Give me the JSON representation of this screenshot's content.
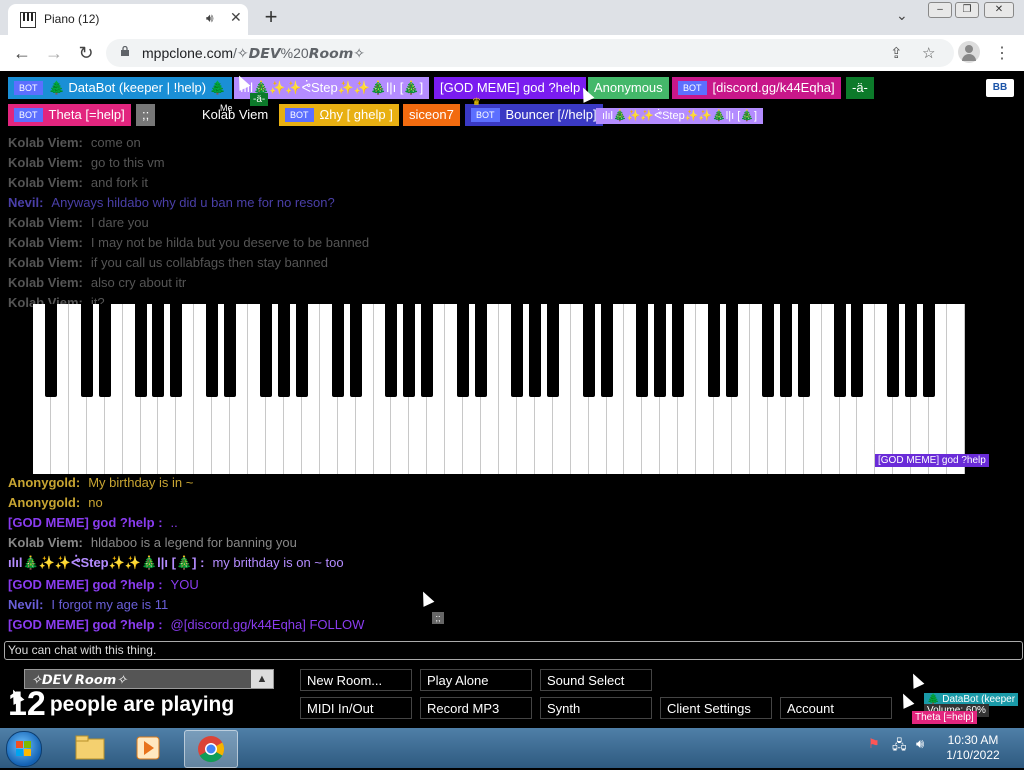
{
  "browser": {
    "tab_title": "Piano (12)",
    "url_host": "mppclone.com",
    "url_path": "/✧𝘿𝙀𝙑%20𝙍𝙤𝙤𝙢✧"
  },
  "users": [
    {
      "label": "🌲 DataBot (keeper | !help) 🌲",
      "bot": true,
      "color": "#1a8fd6"
    },
    {
      "label": "ılıl🎄✨✨ᕚStep✨✨🎄l|ı [🎄]",
      "bot": false,
      "color": "#b48cff"
    },
    {
      "label": "[GOD MEME] god ?help",
      "bot": false,
      "color": "#7a1cf0"
    },
    {
      "label": "Anonymous",
      "bot": false,
      "color": "#44b86a"
    },
    {
      "label": "[discord.gg/k44Eqha]",
      "bot": true,
      "color": "#c8178a"
    },
    {
      "label": "-ä-",
      "bot": false,
      "color": "#0c7a2a"
    },
    {
      "label": "Theta [=help]",
      "bot": true,
      "color": "#e2257e"
    },
    {
      "label": ";;",
      "bot": false,
      "color": "#777777"
    },
    {
      "label": "Kolab Viem",
      "bot": false,
      "color": "#000000"
    },
    {
      "label": "Ωhy [ ghelp ]",
      "bot": true,
      "color": "#e8b012"
    },
    {
      "label": "siceon7",
      "bot": false,
      "color": "#f26b0f"
    },
    {
      "label": "Bouncer [//help]",
      "bot": true,
      "color": "#3a39c4"
    },
    {
      "label": "ılıl🎄✨✨ᕚStep✨✨🎄l|ı [🎄]",
      "bot": false,
      "color": "#b48cff"
    }
  ],
  "me_badge": "Me",
  "mini_tag": "-ä-",
  "bb_label": "BB",
  "chat": [
    {
      "name": "Kolab Viem:",
      "text": "come on",
      "ncolor": "#555",
      "tcolor": "#555"
    },
    {
      "name": "Kolab Viem:",
      "text": "go to this vm",
      "ncolor": "#555",
      "tcolor": "#555"
    },
    {
      "name": "Kolab Viem:",
      "text": "and fork it",
      "ncolor": "#555",
      "tcolor": "#555"
    },
    {
      "name": "Nevil:",
      "text": "Anyways hildabo why did u ban me for no reson?",
      "ncolor": "#4a3fa8",
      "tcolor": "#4a3fa8"
    },
    {
      "name": "Kolab Viem:",
      "text": "I dare you",
      "ncolor": "#555",
      "tcolor": "#555"
    },
    {
      "name": "Kolab Viem:",
      "text": "I may not be hilda but you deserve to be banned",
      "ncolor": "#555",
      "tcolor": "#555"
    },
    {
      "name": "Kolab Viem:",
      "text": "if you call us collabfags then stay banned",
      "ncolor": "#555",
      "tcolor": "#555"
    },
    {
      "name": "Kolab Viem:",
      "text": "also cry about itr",
      "ncolor": "#555",
      "tcolor": "#555"
    },
    {
      "name": "Kolab Viem:",
      "text": "it?",
      "ncolor": "#555",
      "tcolor": "#555"
    },
    {
      "name": "Anonygold:",
      "text": "My birthday is in ~",
      "ncolor": "#c8a532",
      "tcolor": "#c8a532"
    },
    {
      "name": "Anonygold:",
      "text": "no",
      "ncolor": "#c8a532",
      "tcolor": "#c8a532"
    },
    {
      "name": "[GOD MEME] god ?help :",
      "text": "..",
      "ncolor": "#8a3cf0",
      "tcolor": "#8a3cf0"
    },
    {
      "name": "Kolab Viem:",
      "text": "hldaboo is a legend for banning you",
      "ncolor": "#888",
      "tcolor": "#888"
    },
    {
      "name": "ılıl🎄✨✨ᕚStep✨✨🎄l|ı [🎄] :",
      "text": "my brithday is on ~ too",
      "ncolor": "#b48cff",
      "tcolor": "#b48cff"
    },
    {
      "name": "[GOD MEME] god ?help :",
      "text": "YOU",
      "ncolor": "#8a3cf0",
      "tcolor": "#8a3cf0"
    },
    {
      "name": "Nevil:",
      "text": "I forgot my age is 11",
      "ncolor": "#6a5fd8",
      "tcolor": "#6a5fd8"
    },
    {
      "name": "[GOD MEME] god ?help :",
      "text": "@[discord.gg/k44Eqha] FOLLOW",
      "ncolor": "#8a3cf0",
      "tcolor": "#8a3cf0"
    }
  ],
  "cursor_label": "[GOD MEME] god ?help",
  "chat_placeholder": "You can chat with this thing.",
  "room_name": "✧𝘿𝙀𝙑 𝙍𝙤𝙤𝙢✧",
  "player_count": "12",
  "player_text": "people are playing",
  "buttons_row1": [
    "New Room...",
    "Play Alone",
    "Sound Select"
  ],
  "buttons_row2": [
    "MIDI In/Out",
    "Record MP3",
    "Synth",
    "Client Settings",
    "Account"
  ],
  "mini_tags": [
    {
      "label": "🌲 DataBot (keeper",
      "color": "#1a9aa8"
    },
    {
      "label": "Volume: 60%",
      "color": "#333"
    },
    {
      "label": "Theta [=help]",
      "color": "#e2257e"
    }
  ],
  "taskbar": {
    "time": "10:30 AM",
    "date": "1/10/2022"
  }
}
